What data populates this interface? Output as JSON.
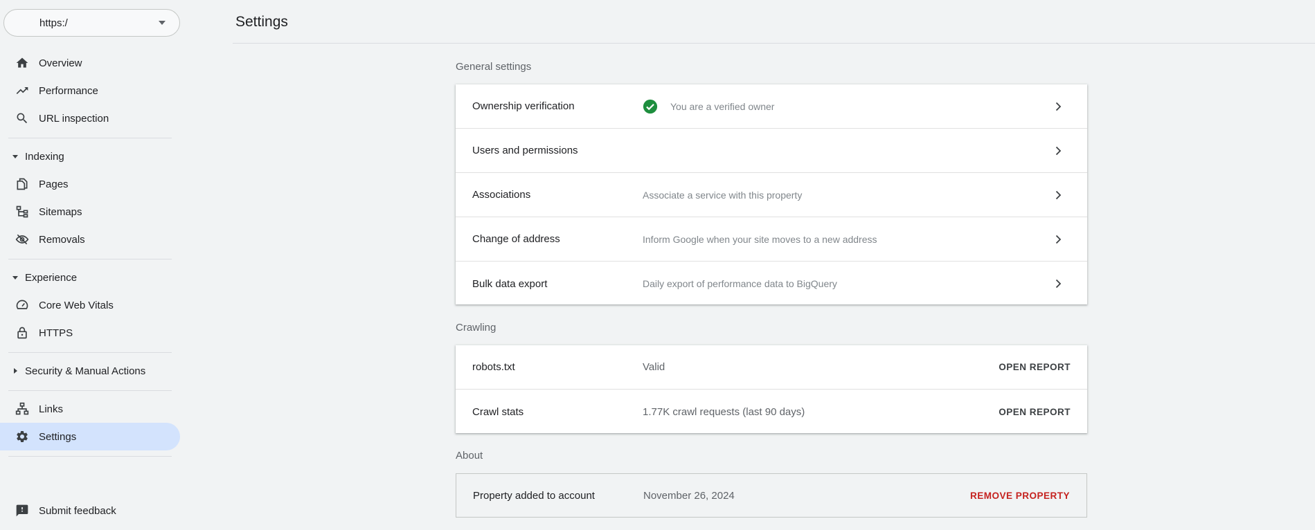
{
  "property_selector": {
    "value": "https:/"
  },
  "sidebar": {
    "top_items": [
      {
        "label": "Overview",
        "icon": "home-icon"
      },
      {
        "label": "Performance",
        "icon": "trending-up-icon"
      },
      {
        "label": "URL inspection",
        "icon": "search-icon"
      }
    ],
    "indexing": {
      "header": "Indexing",
      "items": [
        {
          "label": "Pages",
          "icon": "pages-icon"
        },
        {
          "label": "Sitemaps",
          "icon": "sitemap-icon"
        },
        {
          "label": "Removals",
          "icon": "visibility-off-icon"
        }
      ]
    },
    "experience": {
      "header": "Experience",
      "items": [
        {
          "label": "Core Web Vitals",
          "icon": "speedometer-icon"
        },
        {
          "label": "HTTPS",
          "icon": "lock-icon"
        }
      ]
    },
    "security": {
      "header": "Security & Manual Actions"
    },
    "bottom_items": [
      {
        "label": "Links",
        "icon": "links-icon"
      },
      {
        "label": "Settings",
        "icon": "gear-icon",
        "active": true
      }
    ],
    "feedback": {
      "label": "Submit feedback",
      "icon": "feedback-icon"
    }
  },
  "page": {
    "title": "Settings"
  },
  "general": {
    "title": "General settings",
    "rows": [
      {
        "title": "Ownership verification",
        "desc": "You are a verified owner"
      },
      {
        "title": "Users and permissions",
        "desc": ""
      },
      {
        "title": "Associations",
        "desc": "Associate a service with this property"
      },
      {
        "title": "Change of address",
        "desc": "Inform Google when your site moves to a new address"
      },
      {
        "title": "Bulk data export",
        "desc": "Daily export of performance data to BigQuery"
      }
    ]
  },
  "crawling": {
    "title": "Crawling",
    "rows": [
      {
        "title": "robots.txt",
        "value": "Valid",
        "action": "OPEN REPORT"
      },
      {
        "title": "Crawl stats",
        "value": "1.77K crawl requests (last 90 days)",
        "action": "OPEN REPORT"
      }
    ]
  },
  "about": {
    "title": "About",
    "row": {
      "title": "Property added to account",
      "value": "November 26, 2024",
      "action": "REMOVE PROPERTY"
    }
  },
  "colors": {
    "accent_active_bg": "#d3e3fd",
    "verified_green": "#1e8e3e",
    "danger_red": "#c5221f",
    "page_bg": "#f1f3f4"
  }
}
